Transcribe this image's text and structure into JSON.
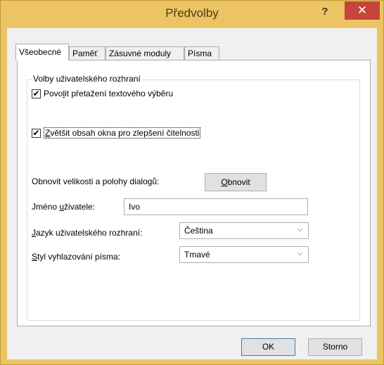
{
  "window": {
    "title": "Předvolby",
    "help_label": "?",
    "close_label": "✕"
  },
  "tabs": [
    {
      "label": "Všeobecné",
      "active": true
    },
    {
      "label": "Paměť"
    },
    {
      "label": "Zásuvné moduly"
    },
    {
      "label": "Písma"
    }
  ],
  "group": {
    "label": "Volby uživatelského rozhraní"
  },
  "options": {
    "drag_selection": {
      "checked": true,
      "label_pre": "Povo",
      "label_ul": "l",
      "label_post": "it přetažení textového výběru"
    },
    "zoom_content": {
      "checked": true,
      "label_pre": "",
      "label_ul": "Z",
      "label_post": "většit obsah okna pro zlepšení čitelnosti"
    }
  },
  "reset": {
    "label": "Obnovit velikosti a polohy dialogů:",
    "button_ul": "O",
    "button_rest": "bnovit"
  },
  "username": {
    "label_pre": "Jméno ",
    "label_ul": "u",
    "label_post": "živatele:",
    "value": "Ivo"
  },
  "language": {
    "label_ul": "J",
    "label_rest": "azyk uživatelského rozhraní:",
    "value": "Čeština"
  },
  "smoothing": {
    "label_ul": "S",
    "label_rest": "tyl vyhlazování písma:",
    "value": "Tmavé"
  },
  "footer": {
    "ok_label": "OK",
    "cancel_label": "Storno"
  },
  "icons": {
    "check": "✔",
    "chevron": "⌵"
  }
}
